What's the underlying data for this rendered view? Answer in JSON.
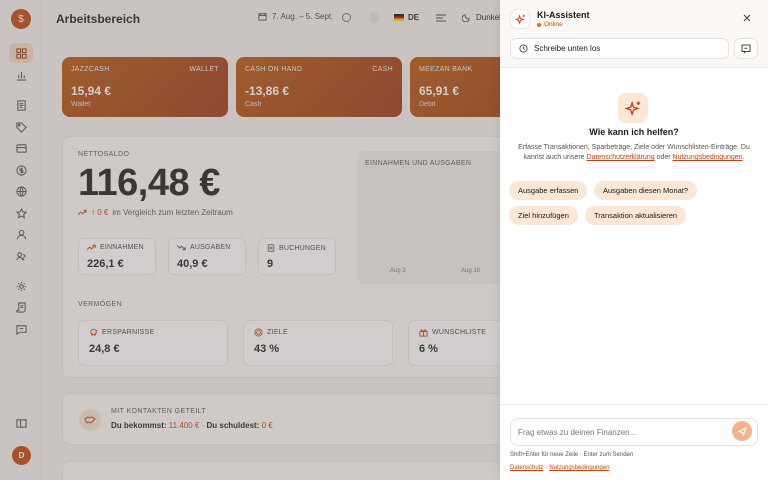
{
  "app": {
    "title": "Arbeitsbereich",
    "logo_glyph": "$",
    "date_range": "7. Aug. – 5. Sept.",
    "language": "DE",
    "theme_label": "Dunkel",
    "user_initial": "D"
  },
  "sidebar": {
    "icons": [
      "dashboard-icon",
      "chart-icon",
      "document-icon",
      "tag-icon",
      "database-icon",
      "dollar-icon",
      "globe-icon",
      "star-icon",
      "user-icon",
      "users-icon",
      "settings-icon",
      "scroll-icon",
      "message-icon",
      "sidebar-toggle-icon"
    ]
  },
  "accounts": [
    {
      "name": "JAZZCASH",
      "type": "WALLET",
      "balance": "15,94 €",
      "subtitle": "Wallet"
    },
    {
      "name": "CASH ON HAND",
      "type": "CASH",
      "balance": "-13,86 €",
      "subtitle": "Cash"
    },
    {
      "name": "MEEZAN BANK",
      "type": "",
      "balance": "65,91 €",
      "subtitle": "Debit"
    }
  ],
  "summary": {
    "net_label": "NETTOSALDO",
    "net_value": "116,48 €",
    "trend_value": "↑ 0 €",
    "trend_text": "im Vergleich zum letzten Zeitraum",
    "income_label": "EINNAHMEN",
    "income_value": "226,1 €",
    "expense_label": "AUSGABEN",
    "expense_value": "40,9 €",
    "bookings_label": "BUCHUNGEN",
    "bookings_value": "9"
  },
  "chart": {
    "title": "EINNAHMEN UND AUSGABEN",
    "ticks": [
      "Aug 3",
      "Aug 10"
    ]
  },
  "assets": {
    "label": "VERMÖGEN",
    "items": [
      {
        "label": "ERSPARNISSE",
        "value": "24,8 €"
      },
      {
        "label": "ZIELE",
        "value": "43 %"
      },
      {
        "label": "WUNSCHLISTE",
        "value": "6 %"
      }
    ]
  },
  "shared": {
    "title": "MIT KONTAKTEN GETEILT",
    "owed_label": "Du bekommst:",
    "owed_value": "11.400 €",
    "separator": "·",
    "owe_label": "Du schuldest:",
    "owe_value": "0 €"
  },
  "assistant": {
    "name": "KI-Assistent",
    "status": "Online",
    "start_label": "Schreibe unten los",
    "help_title": "Wie kann ich helfen?",
    "desc_text": "Erfasse Transaktionen, Sparbeträge, Ziele oder Wunschlisten-Einträge. Du kannst auch unsere",
    "privacy_link": "Datenschutzerklärung",
    "or_text": "oder",
    "terms_link": "Nutzungsbedingungen",
    "period": ".",
    "chips": [
      "Ausgabe erfassen",
      "Ausgaben diesen Monat?",
      "Ziel hinzufügen",
      "Transaktion aktualisieren"
    ],
    "input_placeholder": "Frag etwas zu deinen Finanzen...",
    "hint": "Shift+Enter für neue Zeile · Enter zum Senden",
    "footer_privacy": "Datenschutz",
    "footer_sep": "·",
    "footer_terms": "Nutzungsbedingungen"
  },
  "colors": {
    "accent": "#c2410c",
    "card_start": "#b45309",
    "card_end": "#9a3412",
    "chip_bg": "#fbe7d6"
  }
}
